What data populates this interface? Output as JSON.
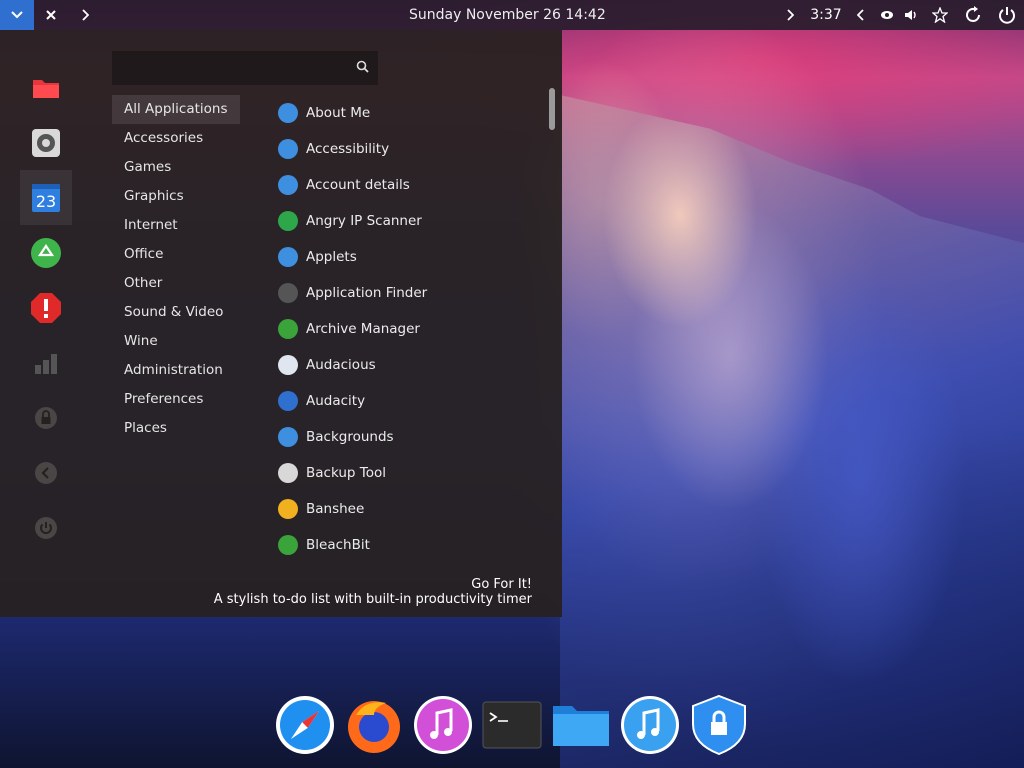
{
  "topbar": {
    "clock": "Sunday November 26   14:42",
    "battery_time": "3:37"
  },
  "menu": {
    "search": {
      "placeholder": ""
    },
    "categories": [
      "All Applications",
      "Accessories",
      "Games",
      "Graphics",
      "Internet",
      "Office",
      "Other",
      "Sound & Video",
      "Wine",
      "Administration",
      "Preferences",
      "Places"
    ],
    "selected_category": "All Applications",
    "apps": [
      {
        "label": "About Me",
        "icon": "user-icon",
        "color": "#3f8fe0"
      },
      {
        "label": "Accessibility",
        "icon": "accessibility-icon",
        "color": "#3f8fe0"
      },
      {
        "label": "Account details",
        "icon": "user-icon",
        "color": "#3f8fe0"
      },
      {
        "label": "Angry IP Scanner",
        "icon": "lightning-icon",
        "color": "#2ea64a"
      },
      {
        "label": "Applets",
        "icon": "gear-icon",
        "color": "#3f8fe0"
      },
      {
        "label": "Application Finder",
        "icon": "magnifier-icon",
        "color": "#555"
      },
      {
        "label": "Archive Manager",
        "icon": "archive-icon",
        "color": "#3aa33a"
      },
      {
        "label": "Audacious",
        "icon": "music-note-icon",
        "color": "#e0e6f0"
      },
      {
        "label": "Audacity",
        "icon": "waveform-icon",
        "color": "#2f6fd0"
      },
      {
        "label": "Backgrounds",
        "icon": "image-icon",
        "color": "#3f8fe0"
      },
      {
        "label": "Backup Tool",
        "icon": "backup-icon",
        "color": "#d8d8d8"
      },
      {
        "label": "Banshee",
        "icon": "music-note-icon",
        "color": "#f0b020"
      },
      {
        "label": "BleachBit",
        "icon": "recycle-icon",
        "color": "#3aa33a"
      }
    ],
    "description": {
      "title": "Go For It!",
      "text": "A stylish to-do list with built-in productivity timer"
    }
  },
  "leftbar": [
    "folder-icon",
    "settings-icon",
    "calendar-icon",
    "recycle-icon",
    "alert-icon",
    "chart-icon",
    "lock-icon",
    "back-icon",
    "power-icon"
  ],
  "calendar_day": "23",
  "dock": [
    "safari-compass-icon",
    "firefox-icon",
    "itunes-icon",
    "terminal-icon",
    "files-folder-icon",
    "music-icon",
    "security-shield-icon"
  ],
  "colors": {
    "accent": "#2f6fd0",
    "panel": "#262120"
  }
}
